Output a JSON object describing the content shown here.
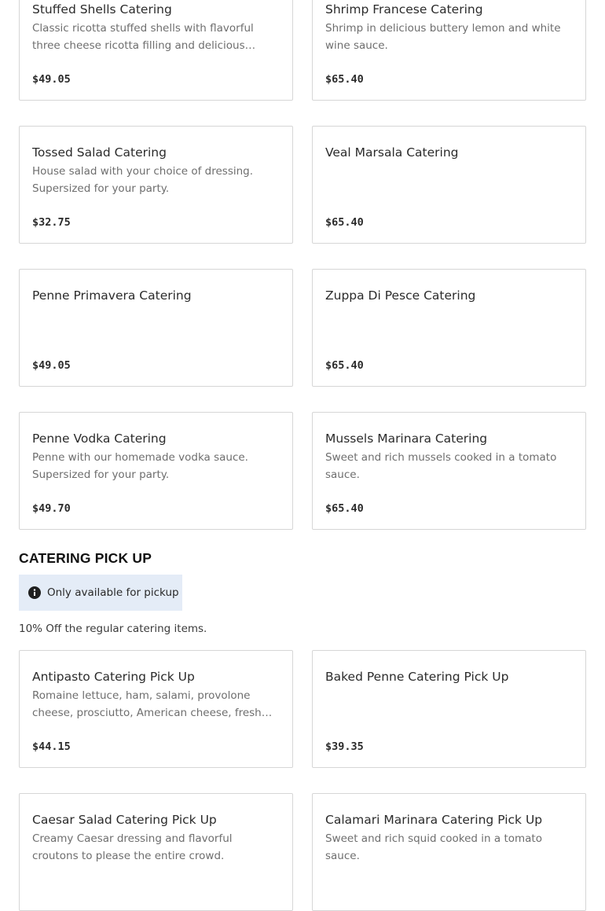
{
  "catering_items": [
    {
      "title": "Stuffed Shells Catering",
      "description": "Classic ricotta stuffed shells with flavorful three cheese ricotta filling and delicious marinara sauce.",
      "price": "$49.05"
    },
    {
      "title": "Shrimp Francese Catering",
      "description": "Shrimp in delicious buttery lemon and white wine sauce.",
      "price": "$65.40"
    },
    {
      "title": "Tossed Salad Catering",
      "description": "House salad with your choice of dressing. Supersized for your party.",
      "price": "$32.75"
    },
    {
      "title": "Veal Marsala Catering",
      "description": "",
      "price": "$65.40"
    },
    {
      "title": "Penne Primavera Catering",
      "description": "",
      "price": "$49.05"
    },
    {
      "title": "Zuppa Di Pesce Catering",
      "description": "",
      "price": "$65.40"
    },
    {
      "title": "Penne Vodka Catering",
      "description": "Penne with our homemade vodka sauce. Supersized for your party.",
      "price": "$49.70"
    },
    {
      "title": "Mussels Marinara Catering",
      "description": "Sweet and rich mussels cooked in a tomato sauce.",
      "price": "$65.40"
    }
  ],
  "pickup_section": {
    "title": "CATERING PICK UP",
    "badge_text": "Only available for pickup",
    "badge_icon": "info-icon",
    "note": "10% Off the regular catering items.",
    "items": [
      {
        "title": "Antipasto Catering Pick Up",
        "description": "Romaine lettuce, ham, salami, provolone cheese, prosciutto, American cheese, fresh mozzarella cheese.",
        "price": "$44.15"
      },
      {
        "title": "Baked Penne Catering Pick Up",
        "description": "",
        "price": "$39.35"
      },
      {
        "title": "Caesar Salad Catering Pick Up",
        "description": "Creamy Caesar dressing and flavorful croutons to please the entire crowd.",
        "price": ""
      },
      {
        "title": "Calamari Marinara Catering Pick Up",
        "description": "Sweet and rich squid cooked in a tomato sauce.",
        "price": ""
      }
    ]
  },
  "colors": {
    "badge_bg": "#e4ecf7",
    "card_border": "#d6d6d6",
    "desc_text": "#6e6e6e"
  }
}
